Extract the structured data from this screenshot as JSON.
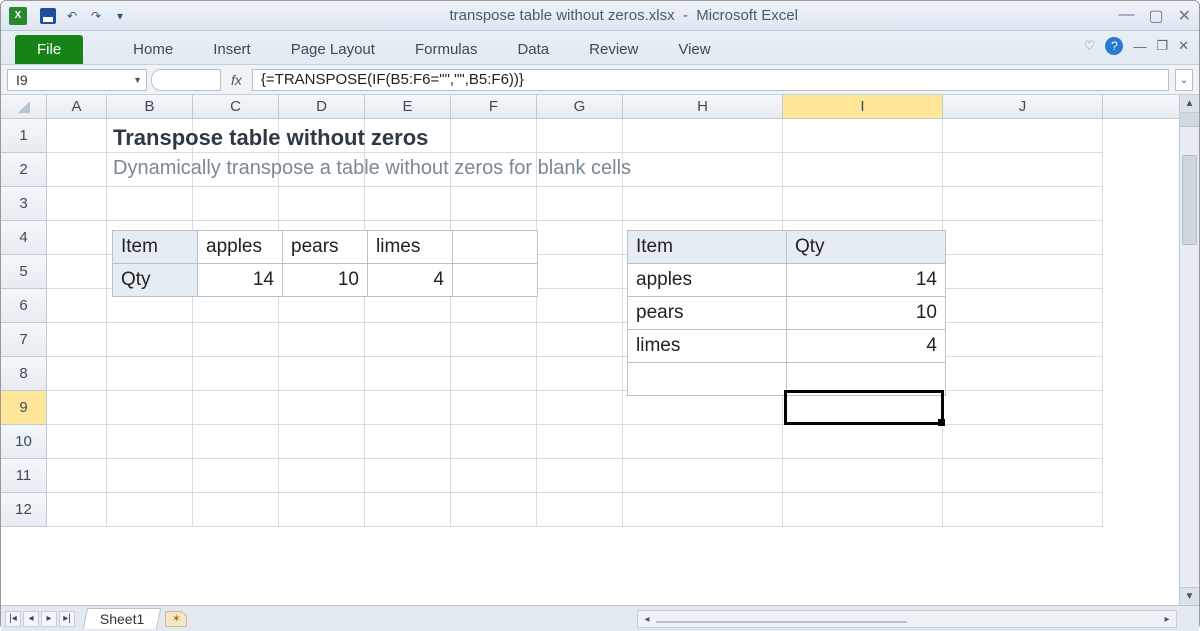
{
  "titlebar": {
    "filename": "transpose table without zeros.xlsx",
    "appname": "Microsoft Excel"
  },
  "ribbon": {
    "file": "File",
    "tabs": [
      "Home",
      "Insert",
      "Page Layout",
      "Formulas",
      "Data",
      "Review",
      "View"
    ]
  },
  "formula_bar": {
    "cell_ref": "I9",
    "fx_label": "fx",
    "formula": "{=TRANSPOSE(IF(B5:F6=\"\",\"\",B5:F6))}"
  },
  "columns": [
    "A",
    "B",
    "C",
    "D",
    "E",
    "F",
    "G",
    "H",
    "I",
    "J"
  ],
  "active_col": "I",
  "row_count": 12,
  "active_row": 9,
  "content": {
    "title": "Transpose table without zeros",
    "subtitle": "Dynamically transpose a table without zeros for blank cells"
  },
  "table1": {
    "r1": [
      "Item",
      "apples",
      "pears",
      "limes",
      ""
    ],
    "r2": [
      "Qty",
      "14",
      "10",
      "4",
      ""
    ]
  },
  "table2": {
    "headers": [
      "Item",
      "Qty"
    ],
    "rows": [
      [
        "apples",
        "14"
      ],
      [
        "pears",
        "10"
      ],
      [
        "limes",
        "4"
      ],
      [
        "",
        ""
      ]
    ]
  },
  "sheet_tab": "Sheet1"
}
